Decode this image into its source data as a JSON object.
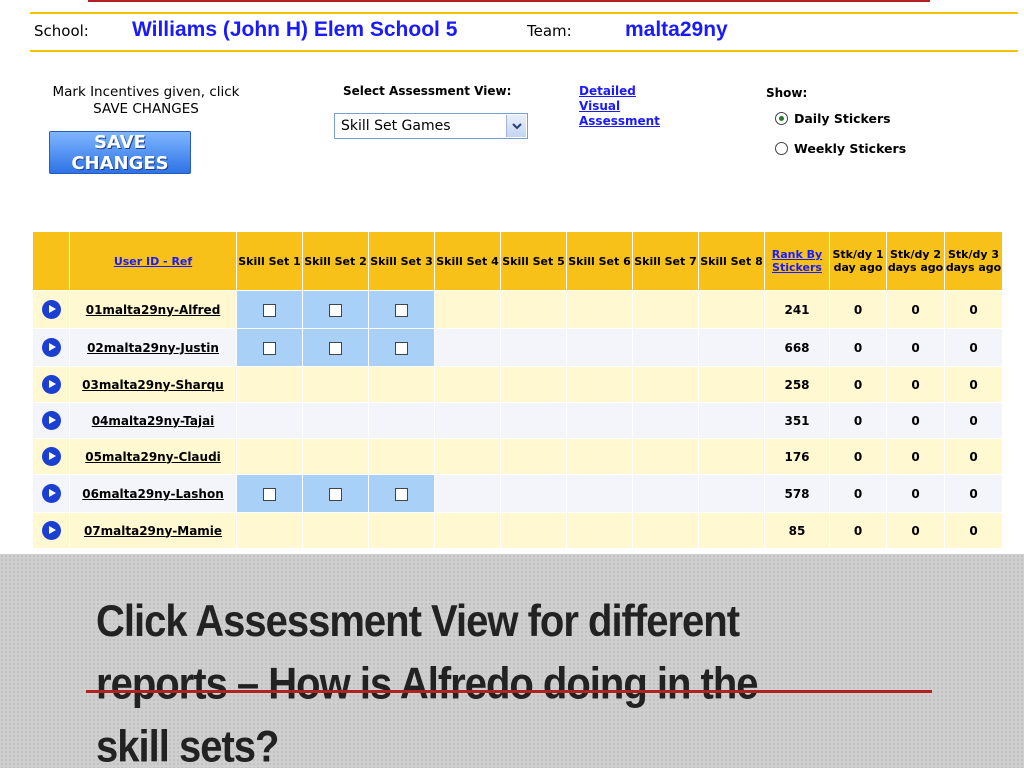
{
  "header": {
    "school_label": "School:",
    "school_name": "Williams (John H) Elem School 5",
    "team_label": "Team:",
    "team_name": "malta29ny"
  },
  "controls": {
    "instruction": "Mark Incentives given, click SAVE CHANGES",
    "save_label": "SAVE CHANGES",
    "view_label": "Select Assessment View:",
    "view_selected": "Skill Set Games",
    "detail_link": "Detailed Visual Assessment",
    "show_label": "Show:",
    "show_options": [
      "Daily Stickers",
      "Weekly Stickers"
    ],
    "show_selected": "Daily Stickers"
  },
  "table": {
    "headers": {
      "user": "User ID - Ref",
      "skill_sets": [
        "Skill Set 1",
        "Skill Set 2",
        "Skill Set 3",
        "Skill Set 4",
        "Skill Set 5",
        "Skill Set 6",
        "Skill Set 7",
        "Skill Set 8"
      ],
      "rank": "Rank By Stickers",
      "stk1": "Stk/dy 1 day ago",
      "stk2": "Stk/dy 2 days ago",
      "stk3": "Stk/dy 3 days ago"
    },
    "rows": [
      {
        "user": "01malta29ny-Alfred",
        "checks": [
          true,
          true,
          true,
          false,
          false,
          false,
          false,
          false
        ],
        "rank": "241",
        "d1": "0",
        "d2": "0",
        "d3": "0"
      },
      {
        "user": "02malta29ny-Justin",
        "checks": [
          true,
          true,
          true,
          false,
          false,
          false,
          false,
          false
        ],
        "rank": "668",
        "d1": "0",
        "d2": "0",
        "d3": "0"
      },
      {
        "user": "03malta29ny-Sharqu",
        "checks": [
          false,
          false,
          false,
          false,
          false,
          false,
          false,
          false
        ],
        "rank": "258",
        "d1": "0",
        "d2": "0",
        "d3": "0"
      },
      {
        "user": "04malta29ny-Tajai",
        "checks": [
          false,
          false,
          false,
          false,
          false,
          false,
          false,
          false
        ],
        "rank": "351",
        "d1": "0",
        "d2": "0",
        "d3": "0"
      },
      {
        "user": "05malta29ny-Claudi",
        "checks": [
          false,
          false,
          false,
          false,
          false,
          false,
          false,
          false
        ],
        "rank": "176",
        "d1": "0",
        "d2": "0",
        "d3": "0"
      },
      {
        "user": "06malta29ny-Lashon",
        "checks": [
          true,
          true,
          true,
          false,
          false,
          false,
          false,
          false
        ],
        "rank": "578",
        "d1": "0",
        "d2": "0",
        "d3": "0"
      },
      {
        "user": "07malta29ny-Mamie",
        "checks": [
          false,
          false,
          false,
          false,
          false,
          false,
          false,
          false
        ],
        "rank": "85",
        "d1": "0",
        "d2": "0",
        "d3": "0"
      }
    ]
  },
  "caption": {
    "text": "Click Assessment View for different reports – How is Alfredo doing in the skill sets?"
  },
  "colors": {
    "header_gold": "#f7c11a",
    "link_blue": "#1a1aff",
    "checkbox_cell": "#a9d1f7",
    "accent_red": "#b22222"
  },
  "icons": {
    "row_action": "play-circle-icon",
    "dropdown": "chevron-down-icon"
  }
}
